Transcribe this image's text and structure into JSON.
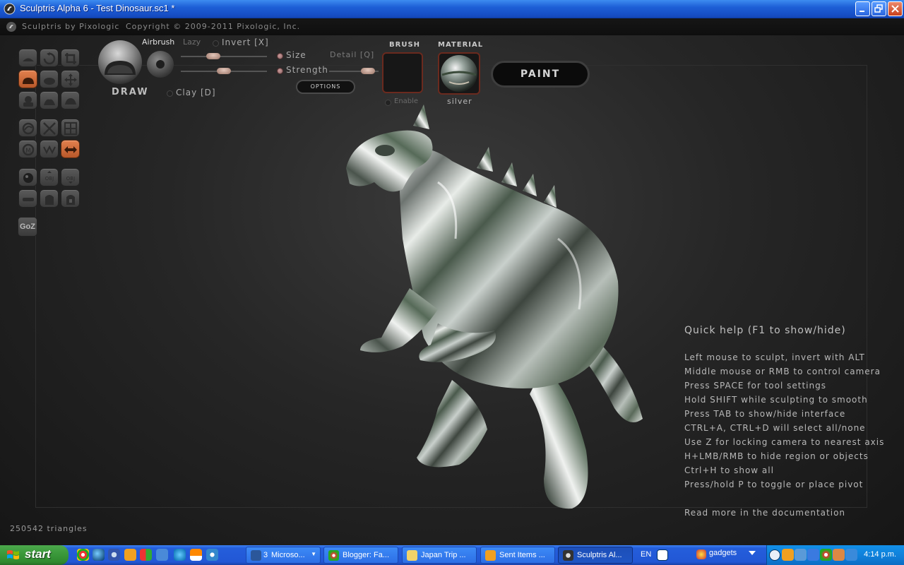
{
  "window": {
    "title": "Sculptris Alpha 6 - Test Dinosaur.sc1 *"
  },
  "header": {
    "brand": "Sculptris by Pixologic",
    "copyright": "Copyright © 2009-2011 Pixologic, Inc."
  },
  "tools": {
    "current_tool": "DRAW",
    "airbrush": "Airbrush",
    "lazy": "Lazy",
    "invert": "Invert [X]",
    "clay": "Clay [D]",
    "size": "Size",
    "strength": "Strength",
    "detail": "Detail [Q]",
    "size_value": 0.35,
    "strength_value": 0.5,
    "detail_value": 0.9,
    "options": "OPTIONS",
    "goz": "GoZ"
  },
  "brush": {
    "label": "BRUSH",
    "enable": "Enable"
  },
  "material": {
    "label": "MATERIAL",
    "name": "silver"
  },
  "paint_button": "PAINT",
  "quick_help": {
    "title": "Quick help (F1 to show/hide)",
    "lines": [
      "Left mouse to sculpt, invert with ALT",
      "Middle mouse or RMB to control camera",
      "Press SPACE for tool settings",
      "Hold SHIFT while sculpting to smooth",
      "Press TAB to show/hide interface",
      "CTRL+A, CTRL+D will select all/none",
      "Use Z for locking camera to nearest axis",
      "H+LMB/RMB to hide region or objects",
      "Ctrl+H to show all",
      "Press/hold P to toggle or place pivot"
    ],
    "more": "Read more in the documentation"
  },
  "status": {
    "triangles": "250542 triangles"
  },
  "taskbar": {
    "start": "start",
    "tasks": [
      {
        "label": "Microso...",
        "badge": "3"
      },
      {
        "label": "Blogger: Fa..."
      },
      {
        "label": "Japan Trip ..."
      },
      {
        "label": "Sent Items ..."
      },
      {
        "label": "Sculptris Al..."
      }
    ],
    "lang": "EN",
    "gadgets": "gadgets",
    "clock": "4:14 p.m."
  },
  "colors": {
    "active_tool": "#d06a38",
    "frame_accent": "#6b2a1e",
    "xp_blue": "#245edb",
    "start_green": "#3c9a3c"
  }
}
